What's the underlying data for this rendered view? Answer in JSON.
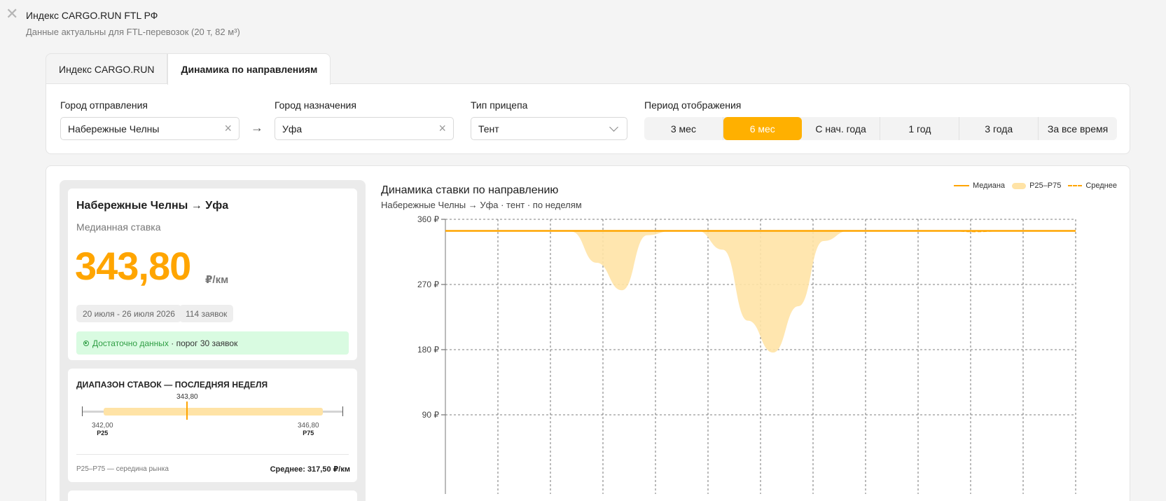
{
  "header": {
    "title": "Индекс CARGO.RUN FTL РФ",
    "subtitle": "Данные актуальны для FTL-перевозок (20 т, 82 м³)"
  },
  "tabs": [
    {
      "label": "Индекс CARGO.RUN",
      "active": false
    },
    {
      "label": "Динамика по направлениям",
      "active": true
    }
  ],
  "filters": {
    "origin": {
      "label": "Город отправления",
      "value": "Набережные Челны"
    },
    "destination": {
      "label": "Город назначения",
      "value": "Уфа"
    },
    "trailer": {
      "label": "Тип прицепа",
      "value": "Тент"
    },
    "period": {
      "label": "Период отображения",
      "options": [
        "3 мес",
        "6 мес",
        "С нач. года",
        "1 год",
        "3 года",
        "За все время"
      ],
      "selected": "6 мес"
    }
  },
  "summary": {
    "route": "Набережные Челны → Уфа",
    "median_label": "Медианная ставка",
    "median_value": "343,80",
    "unit": "₽/км",
    "date_range": "20 июля - 26 июля 2026",
    "orders": "114 заявок",
    "status_ok": "Достаточно данных",
    "status_rest": " · порог 30 заявок"
  },
  "range": {
    "title": "ДИАПАЗОН СТАВОК — ПОСЛЕДНЯЯ НЕДЕЛЯ",
    "median": "343,80",
    "p25_value": "342,00",
    "p25_label": "P25",
    "p75_value": "346,80",
    "p75_label": "P75",
    "footer_left": "P25–P75 — середина рынка",
    "footer_right": "Среднее: 317,50 ₽/км"
  },
  "chart": {
    "title": "Динамика ставки по направлению",
    "subtitle": "Набережные Челны → Уфа · тент · по неделям",
    "legend": {
      "median": "Медиана",
      "band": "P25–P75",
      "mean": "Среднее"
    },
    "colors": {
      "accent": "#ffa500",
      "band": "#ffe3a6",
      "grid": "#555555"
    }
  },
  "chart_data": {
    "type": "area",
    "y_ticks": [
      "360 ₽",
      "270 ₽",
      "180 ₽",
      "90 ₽"
    ],
    "ylim": [
      0,
      360
    ],
    "weeks": 26,
    "median": [
      344,
      344,
      344,
      344,
      344,
      344,
      344,
      344,
      344,
      344,
      344,
      344,
      344,
      344,
      344,
      344,
      344,
      344,
      344,
      344,
      344,
      344,
      344,
      344,
      344,
      344
    ],
    "p25": [
      344,
      344,
      344,
      344,
      344,
      343,
      300,
      262,
      338,
      344,
      344,
      318,
      220,
      176,
      240,
      330,
      344,
      344,
      344,
      344,
      344,
      344,
      344,
      344,
      344,
      344
    ],
    "p75": [
      345,
      345,
      345,
      345,
      345,
      345,
      345,
      345,
      345,
      345,
      345,
      345,
      345,
      345,
      345,
      345,
      345,
      345,
      345,
      345,
      345,
      345,
      345,
      345,
      345,
      345
    ],
    "mean": [
      344,
      344,
      344,
      344,
      344,
      344,
      344,
      344,
      344,
      344,
      344,
      344,
      344,
      344,
      344,
      344,
      344,
      344,
      344,
      344,
      344,
      343,
      344,
      344,
      344,
      344
    ],
    "grid": true,
    "legend_position": "top-right"
  }
}
